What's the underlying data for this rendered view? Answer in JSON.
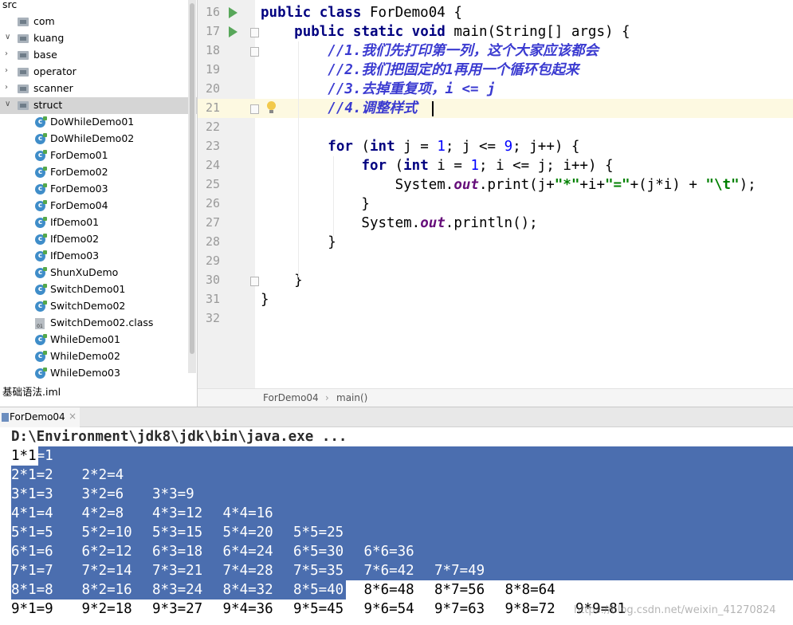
{
  "project_tree": {
    "items": [
      {
        "label": "src",
        "kind": "folder-root",
        "indent": 0,
        "expanded": null
      },
      {
        "label": "com",
        "kind": "package",
        "indent": 1,
        "expanded": null
      },
      {
        "label": "kuang",
        "kind": "package",
        "indent": 1,
        "expanded": true
      },
      {
        "label": "base",
        "kind": "package",
        "indent": 2,
        "expanded": false
      },
      {
        "label": "operator",
        "kind": "package",
        "indent": 2,
        "expanded": false
      },
      {
        "label": "scanner",
        "kind": "package",
        "indent": 2,
        "expanded": false
      },
      {
        "label": "struct",
        "kind": "package",
        "indent": 2,
        "expanded": true,
        "selected": true
      },
      {
        "label": "DoWhileDemo01",
        "kind": "class",
        "indent": 3
      },
      {
        "label": "DoWhileDemo02",
        "kind": "class",
        "indent": 3
      },
      {
        "label": "ForDemo01",
        "kind": "class",
        "indent": 3
      },
      {
        "label": "ForDemo02",
        "kind": "class",
        "indent": 3
      },
      {
        "label": "ForDemo03",
        "kind": "class",
        "indent": 3
      },
      {
        "label": "ForDemo04",
        "kind": "class",
        "indent": 3
      },
      {
        "label": "IfDemo01",
        "kind": "class",
        "indent": 3
      },
      {
        "label": "IfDemo02",
        "kind": "class",
        "indent": 3
      },
      {
        "label": "IfDemo03",
        "kind": "class",
        "indent": 3
      },
      {
        "label": "ShunXuDemo",
        "kind": "class",
        "indent": 3
      },
      {
        "label": "SwitchDemo01",
        "kind": "class",
        "indent": 3
      },
      {
        "label": "SwitchDemo02",
        "kind": "class",
        "indent": 3
      },
      {
        "label": "SwitchDemo02.class",
        "kind": "classfile",
        "indent": 3
      },
      {
        "label": "WhileDemo01",
        "kind": "class",
        "indent": 3
      },
      {
        "label": "WhileDemo02",
        "kind": "class",
        "indent": 3
      },
      {
        "label": "WhileDemo03",
        "kind": "class",
        "indent": 3
      },
      {
        "label": "基础语法.iml",
        "kind": "file",
        "indent": 0
      }
    ]
  },
  "editor": {
    "lines": [
      {
        "num": "16",
        "run": true,
        "fold": false,
        "tokens": [
          [
            "kw",
            "public class "
          ],
          [
            "plain",
            "ForDemo04 {"
          ]
        ]
      },
      {
        "num": "17",
        "run": true,
        "fold": true,
        "tokens": [
          [
            "plain",
            "    "
          ],
          [
            "kw",
            "public static void "
          ],
          [
            "plain",
            "main(String[] args) {"
          ]
        ]
      },
      {
        "num": "18",
        "fold": true,
        "tokens": [
          [
            "plain",
            "        "
          ],
          [
            "cm",
            "//1.我们先打印第一列，这个大家应该都会"
          ]
        ]
      },
      {
        "num": "19",
        "tokens": [
          [
            "plain",
            "        "
          ],
          [
            "cm",
            "//2.我们把固定的1再用一个循环包起来"
          ]
        ]
      },
      {
        "num": "20",
        "tokens": [
          [
            "plain",
            "        "
          ],
          [
            "cm",
            "//3.去掉重复项，i <= j"
          ]
        ]
      },
      {
        "num": "21",
        "fold": true,
        "current": true,
        "tokens": [
          [
            "plain",
            "        "
          ],
          [
            "cm",
            "//4.调整样式"
          ]
        ]
      },
      {
        "num": "22",
        "tokens": []
      },
      {
        "num": "23",
        "tokens": [
          [
            "plain",
            "        "
          ],
          [
            "kw",
            "for "
          ],
          [
            "plain",
            "("
          ],
          [
            "kw",
            "int "
          ],
          [
            "plain",
            "j = "
          ],
          [
            "num",
            "1"
          ],
          [
            "plain",
            "; j <= "
          ],
          [
            "num",
            "9"
          ],
          [
            "plain",
            "; j++) {"
          ]
        ]
      },
      {
        "num": "24",
        "tokens": [
          [
            "plain",
            "            "
          ],
          [
            "kw",
            "for "
          ],
          [
            "plain",
            "("
          ],
          [
            "kw",
            "int "
          ],
          [
            "plain",
            "i = "
          ],
          [
            "num",
            "1"
          ],
          [
            "plain",
            "; i <= j; i++) {"
          ]
        ]
      },
      {
        "num": "25",
        "tokens": [
          [
            "plain",
            "                System."
          ],
          [
            "fld",
            "out"
          ],
          [
            "plain",
            ".print(j+"
          ],
          [
            "str",
            "\"*\""
          ],
          [
            "plain",
            "+i+"
          ],
          [
            "str",
            "\"=\""
          ],
          [
            "plain",
            "+(j*i) + "
          ],
          [
            "str",
            "\"\\t\""
          ],
          [
            "plain",
            ");"
          ]
        ]
      },
      {
        "num": "26",
        "tokens": [
          [
            "plain",
            "            }"
          ]
        ]
      },
      {
        "num": "27",
        "tokens": [
          [
            "plain",
            "            System."
          ],
          [
            "fld",
            "out"
          ],
          [
            "plain",
            ".println();"
          ]
        ]
      },
      {
        "num": "28",
        "tokens": [
          [
            "plain",
            "        }"
          ]
        ]
      },
      {
        "num": "29",
        "tokens": []
      },
      {
        "num": "30",
        "fold": true,
        "tokens": [
          [
            "plain",
            "    }"
          ]
        ]
      },
      {
        "num": "31",
        "tokens": [
          [
            "plain",
            "}"
          ]
        ]
      },
      {
        "num": "32",
        "tokens": []
      }
    ]
  },
  "breadcrumb": {
    "file": "ForDemo04",
    "separator": "›",
    "method": "main()"
  },
  "run_panel": {
    "tab_label": "ForDemo04",
    "tab_close": "×",
    "command": "D:\\Environment\\jdk8\\jdk\\bin\\java.exe ...",
    "output_rows": [
      [
        "1*1=1"
      ],
      [
        "2*1=2",
        "2*2=4"
      ],
      [
        "3*1=3",
        "3*2=6",
        "3*3=9"
      ],
      [
        "4*1=4",
        "4*2=8",
        "4*3=12",
        "4*4=16"
      ],
      [
        "5*1=5",
        "5*2=10",
        "5*3=15",
        "5*4=20",
        "5*5=25"
      ],
      [
        "6*1=6",
        "6*2=12",
        "6*3=18",
        "6*4=24",
        "6*5=30",
        "6*6=36"
      ],
      [
        "7*1=7",
        "7*2=14",
        "7*3=21",
        "7*4=28",
        "7*5=35",
        "7*6=42",
        "7*7=49"
      ],
      [
        "8*1=8",
        "8*2=16",
        "8*3=24",
        "8*4=32",
        "8*5=40",
        "8*6=48",
        "8*7=56",
        "8*8=64"
      ],
      [
        "9*1=9",
        "9*2=18",
        "9*3=27",
        "9*4=36",
        "9*5=45",
        "9*6=54",
        "9*7=63",
        "9*8=72",
        "9*9=81"
      ]
    ]
  },
  "watermark": "https://blog.csdn.net/weixin_41270824",
  "colors": {
    "selection": "#4b6eaf",
    "keyword": "#000080",
    "comment": "#3a3ad0",
    "string": "#008000",
    "number": "#0000ff",
    "field": "#660e7a",
    "caret_line": "#fdf9e1"
  }
}
